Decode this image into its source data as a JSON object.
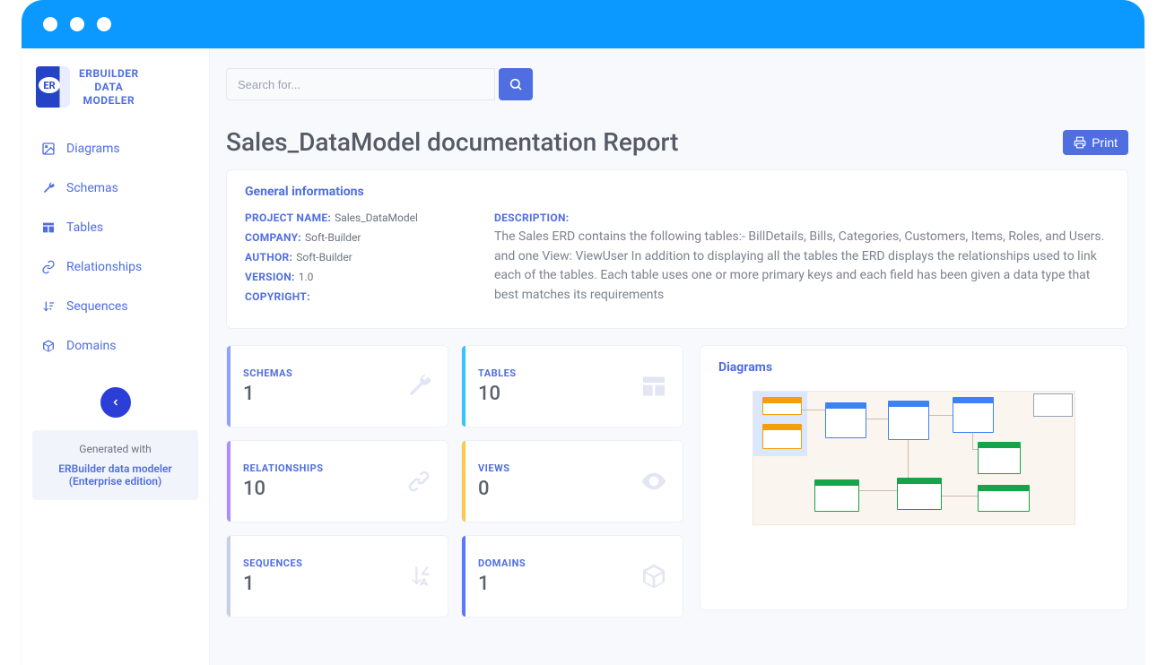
{
  "brand": {
    "line1": "ERBUILDER",
    "line2": "DATA",
    "line3": "MODELER",
    "logo_text": "ER"
  },
  "search": {
    "placeholder": "Search for..."
  },
  "sidebar": {
    "items": [
      {
        "label": "Diagrams"
      },
      {
        "label": "Schemas"
      },
      {
        "label": "Tables"
      },
      {
        "label": "Relationships"
      },
      {
        "label": "Sequences"
      },
      {
        "label": "Domains"
      }
    ]
  },
  "generated": {
    "with": "Generated with",
    "product": "ERBuilder data modeler",
    "edition": "(Enterprise edition)"
  },
  "page": {
    "title": "Sales_DataModel documentation Report",
    "print": "Print"
  },
  "general": {
    "title": "General informations",
    "project_name_k": "PROJECT NAME:",
    "project_name": "Sales_DataModel",
    "company_k": "COMPANY:",
    "company": "Soft-Builder",
    "author_k": "AUTHOR:",
    "author": "Soft-Builder",
    "version_k": "VERSION:",
    "version": "1.0",
    "copyright_k": "COPYRIGHT:",
    "copyright": "",
    "description_k": "DESCRIPTION:",
    "description": "The Sales ERD contains the following tables:- BillDetails, Bills, Categories, Customers, Items, Roles, and Users. and one View: ViewUser In addition to displaying all the tables the ERD displays the relationships used to link each of the tables. Each table uses one or more primary keys and each field has been given a data type that best matches its requirements"
  },
  "stats": {
    "schemas": {
      "label": "SCHEMAS",
      "value": "1",
      "accent": "#8fa0ff"
    },
    "tables": {
      "label": "TABLES",
      "value": "10",
      "accent": "#37c3ff"
    },
    "relationships": {
      "label": "RELATIONSHIPS",
      "value": "10",
      "accent": "#b18cff"
    },
    "views": {
      "label": "VIEWS",
      "value": "0",
      "accent": "#ffc94d"
    },
    "sequences": {
      "label": "SEQUENCES",
      "value": "1",
      "accent": "#c7cfe6"
    },
    "domains": {
      "label": "DOMAINS",
      "value": "1",
      "accent": "#5a78ff"
    }
  },
  "diagrams_panel": {
    "title": "Diagrams"
  },
  "colors": {
    "primary": "#4f6ee0"
  }
}
